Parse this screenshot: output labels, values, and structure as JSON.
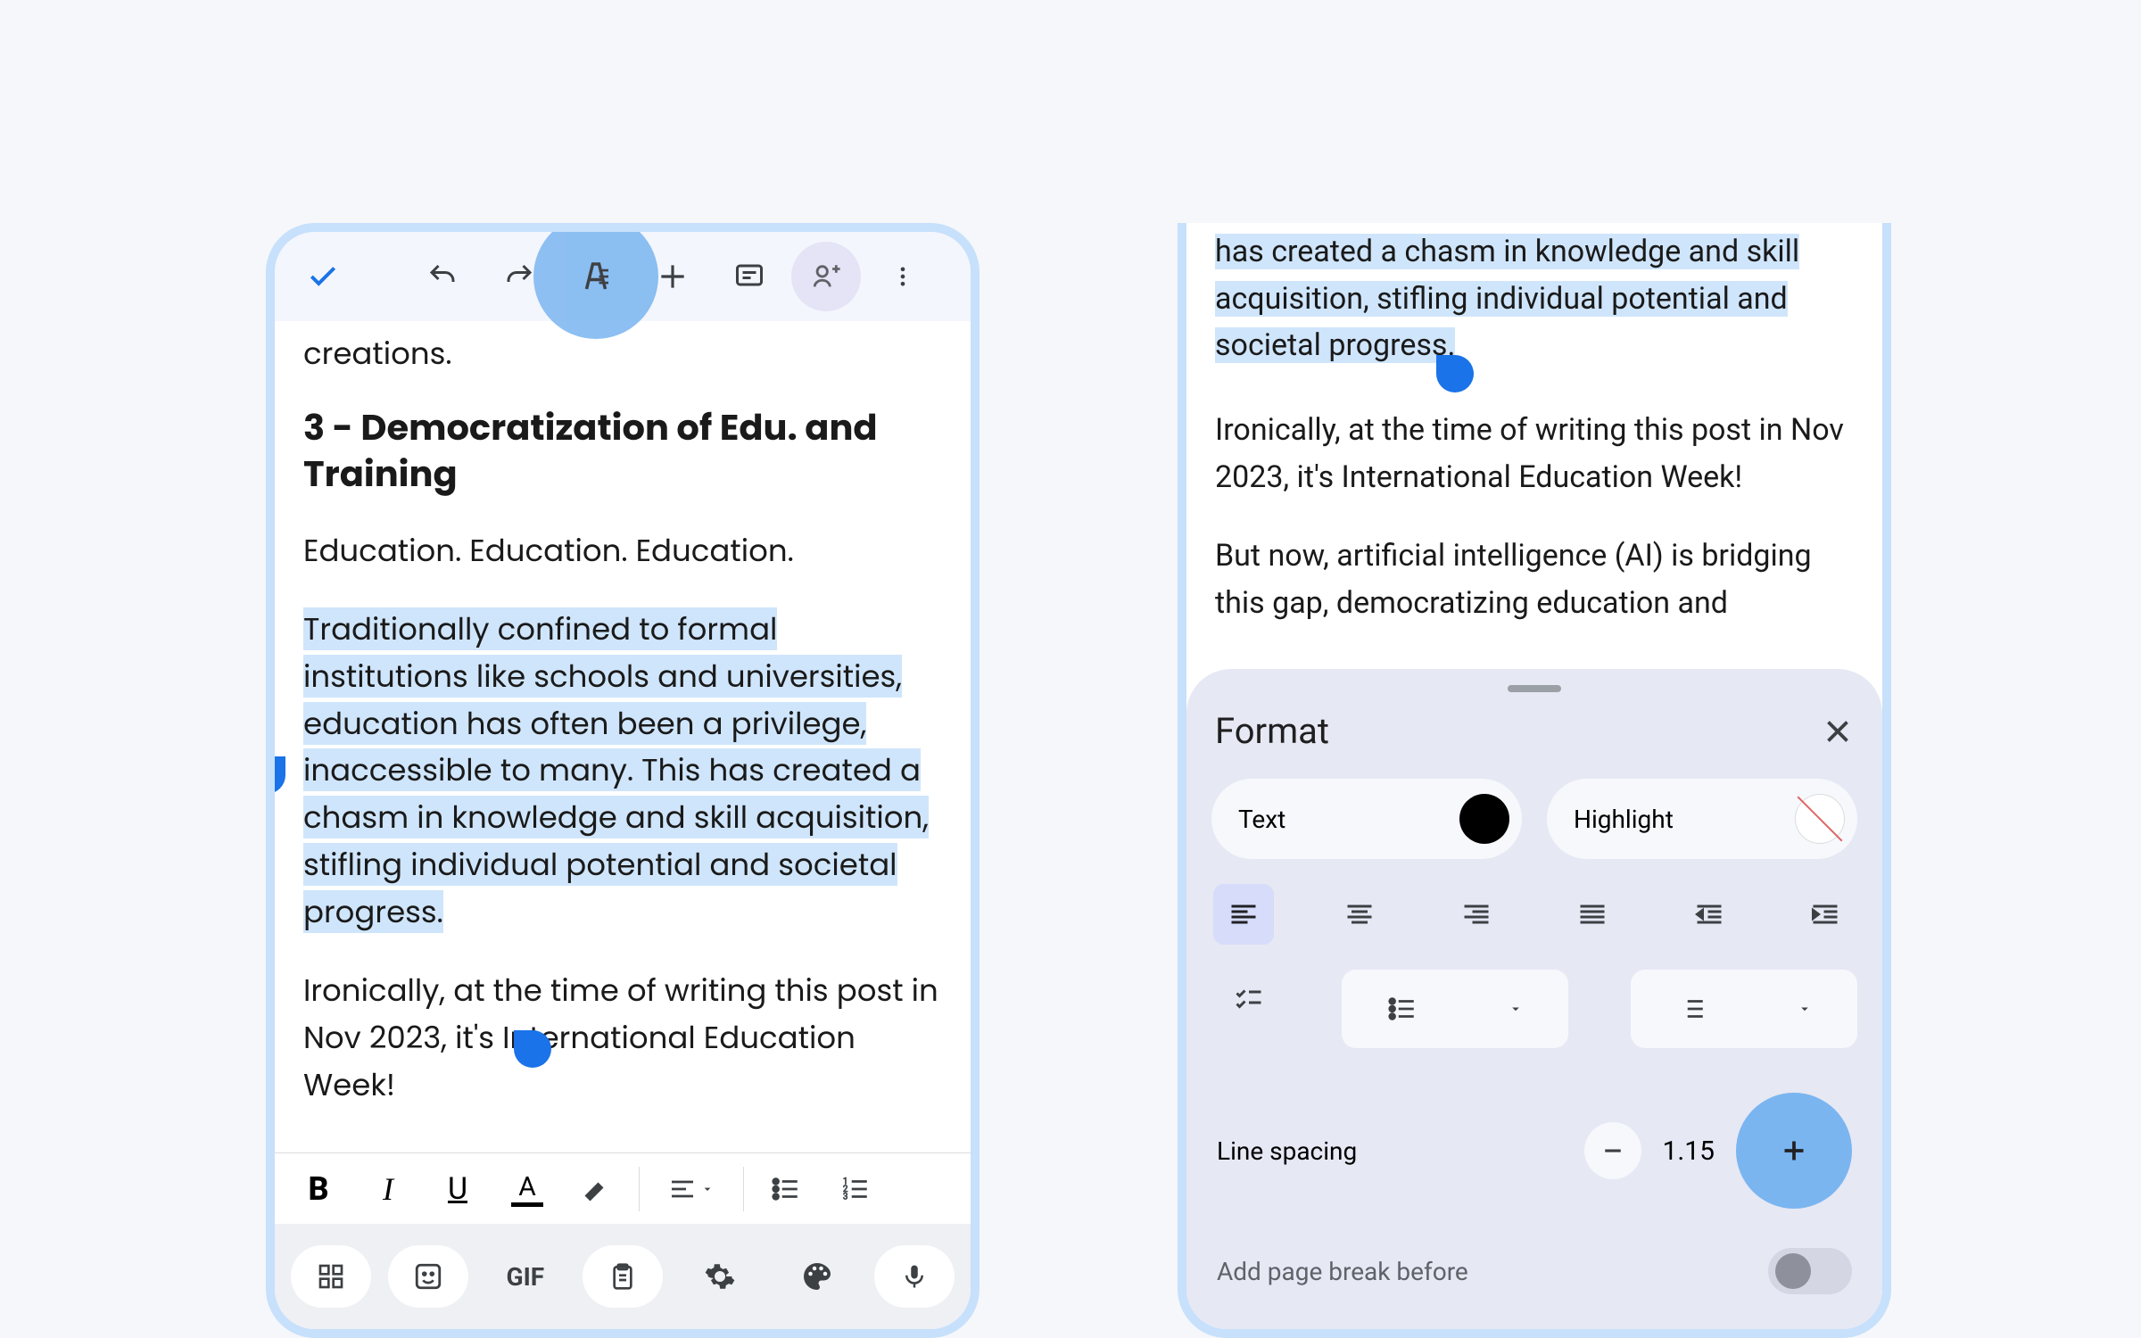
{
  "left": {
    "cutoff_text": "creations.",
    "heading": "3 - Democratization of Edu. and Training",
    "para1": "Education. Education. Education.",
    "para2_selected": "Traditionally confined to formal institutions like schools and universities, education has often been a privilege, inaccessible to many. This has created a chasm in knowledge and skill acquisition, stifling individual potential and societal progress.",
    "para3": "Ironically, at the time of writing this post in Nov 2023, it's International Education Week!"
  },
  "right": {
    "sel_tail": "has created a chasm in knowledge and skill acquisition, stifling individual potential and societal progress.",
    "para_ironic": "Ironically, at the time of writing this post in Nov 2023, it's International Education Week!",
    "para_now": "But now, artificial intelligence (AI) is bridging this gap, democratizing education and",
    "sheet": {
      "title": "Format",
      "text_label": "Text",
      "highlight_label": "Highlight",
      "line_spacing_label": "Line spacing",
      "line_spacing_value": "1.15",
      "page_break_label": "Add page break before"
    }
  },
  "keyboard": {
    "gif": "GIF"
  },
  "colors": {
    "accent_blue": "#1a73e8",
    "circle_blue": "#7ab5f0",
    "selection_bg": "#cfe5fb"
  }
}
